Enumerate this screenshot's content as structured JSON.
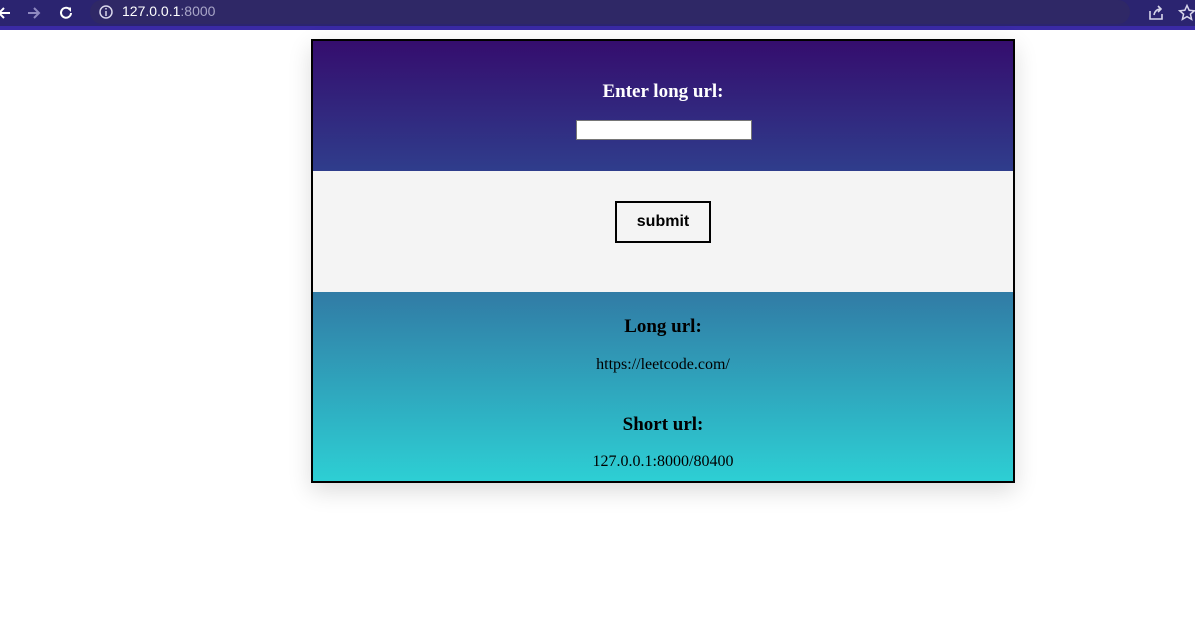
{
  "browser": {
    "url_host": "127.0.0.1",
    "url_port": ":8000"
  },
  "form": {
    "input_label": "Enter long url:",
    "input_value": "",
    "submit_label": "submit"
  },
  "result": {
    "long_heading": "Long url:",
    "long_value": "https://leetcode.com/",
    "short_heading": "Short url:",
    "short_value": "127.0.0.1:8000/80400"
  },
  "colors": {
    "toolbar": "#2b2470",
    "top_gradient": [
      "#350d6e",
      "#2f3d8c"
    ],
    "middle": "#f4f4f4",
    "bottom_gradient": [
      "#317ba5",
      "#2dcfd4"
    ]
  },
  "icons": [
    "back-arrow-icon",
    "forward-arrow-icon",
    "reload-icon",
    "info-icon",
    "share-icon",
    "star-icon"
  ]
}
